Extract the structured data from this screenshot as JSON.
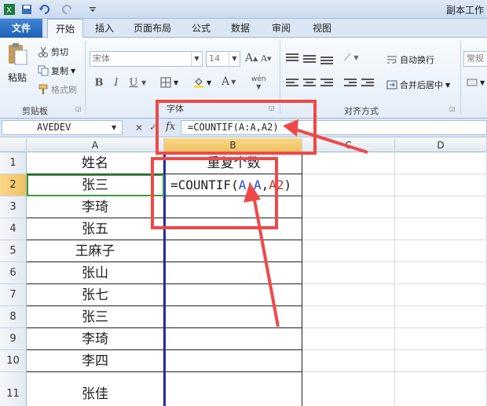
{
  "window": {
    "title": "副本工作"
  },
  "tabs": [
    {
      "id": "file",
      "label": "文件"
    },
    {
      "id": "home",
      "label": "开始"
    },
    {
      "id": "insert",
      "label": "插入"
    },
    {
      "id": "page_layout",
      "label": "页面布局"
    },
    {
      "id": "formulas",
      "label": "公式"
    },
    {
      "id": "data",
      "label": "数据"
    },
    {
      "id": "review",
      "label": "审阅"
    },
    {
      "id": "view",
      "label": "视图"
    }
  ],
  "ribbon": {
    "clipboard": {
      "label": "剪贴板",
      "paste": "粘贴",
      "cut": "剪切",
      "copy": "复制",
      "format_painter": "格式刷"
    },
    "font": {
      "label": "字体",
      "font_name": "宋体",
      "font_size": "14",
      "grow": "A",
      "shrink": "A",
      "bold": "B",
      "italic": "I",
      "underline": "U",
      "font_color": "A",
      "phonetic": "wén"
    },
    "alignment": {
      "label": "对齐方式",
      "wrap_text": "自动换行",
      "merge_center": "合并后居中"
    },
    "number": {
      "format": "常规"
    }
  },
  "formula_bar": {
    "name_box": "AVEDEV",
    "fx": "fx",
    "formula": "=COUNTIF(A:A,A2)"
  },
  "sheet": {
    "columns": [
      "A",
      "B",
      "C",
      "D"
    ],
    "rows": [
      {
        "n": "1",
        "a": "姓名",
        "b": "重复个数"
      },
      {
        "n": "2",
        "a": "张三",
        "b": ""
      },
      {
        "n": "3",
        "a": "李琦",
        "b": ""
      },
      {
        "n": "4",
        "a": "张五",
        "b": ""
      },
      {
        "n": "5",
        "a": "王麻子",
        "b": ""
      },
      {
        "n": "6",
        "a": "张山",
        "b": ""
      },
      {
        "n": "7",
        "a": "张七",
        "b": ""
      },
      {
        "n": "8",
        "a": "张三",
        "b": ""
      },
      {
        "n": "9",
        "a": "李琦",
        "b": ""
      },
      {
        "n": "10",
        "a": "李四",
        "b": ""
      },
      {
        "n": "11",
        "a": "张佳",
        "b": ""
      }
    ],
    "b2_formula": {
      "prefix": "=COUNTIF(",
      "ref1": "A:A",
      "comma": ",",
      "ref2": "A2",
      "suffix": ")"
    }
  },
  "colors": {
    "accent_file": "#2a6cc4",
    "annotation": "#f04848",
    "range_ref": "#2b45d6"
  }
}
